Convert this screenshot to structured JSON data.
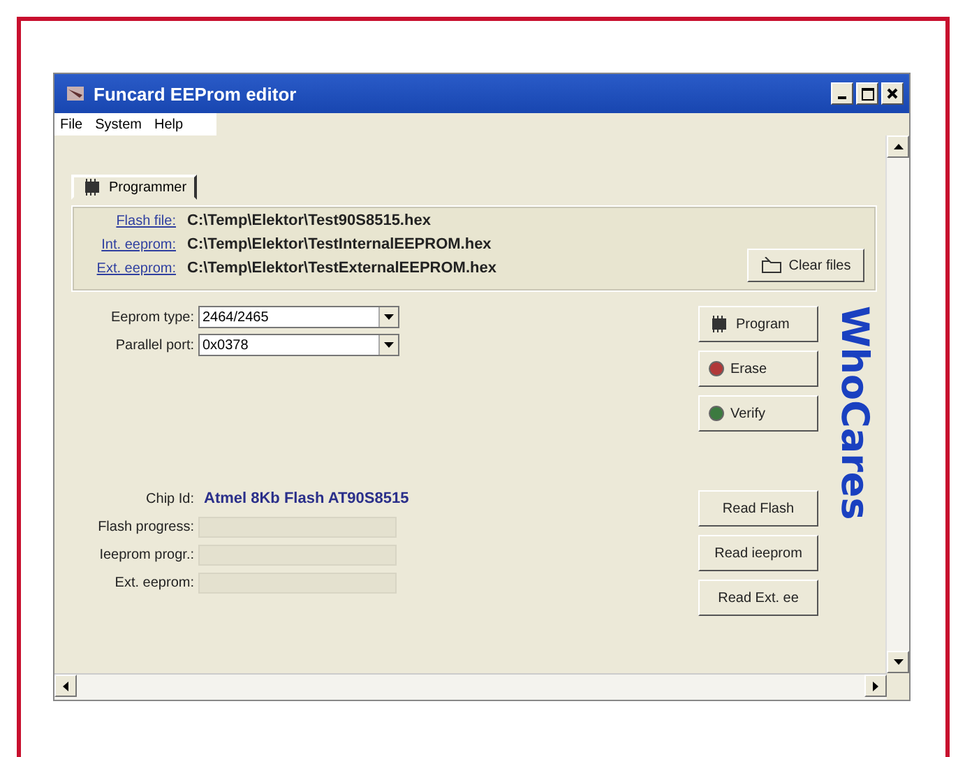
{
  "window": {
    "title": "Funcard EEProm editor"
  },
  "menu": [
    "File",
    "System",
    "Help"
  ],
  "tabs": [
    {
      "label": "Programmer",
      "selected": true
    }
  ],
  "files": [
    {
      "label": "Flash file:",
      "path": "C:\\Temp\\Elektor\\Test90S8515.hex"
    },
    {
      "label": "Int. eeprom:",
      "path": "C:\\Temp\\Elektor\\TestInternalEEPROM.hex"
    },
    {
      "label": "Ext. eeprom:",
      "path": "C:\\Temp\\Elektor\\TestExternalEEPROM.hex"
    }
  ],
  "clear_button": "Clear files",
  "settings": [
    {
      "label": "Eeprom type:",
      "value": "2464/2465"
    },
    {
      "label": "Parallel port:",
      "value": "0x0378"
    }
  ],
  "chip": {
    "label": "Chip Id:",
    "value": "Atmel 8Kb Flash AT90S8515"
  },
  "progress": [
    {
      "label": "Flash progress:",
      "level": 0
    },
    {
      "label": "Ieeprom progr.:",
      "level": 0
    },
    {
      "label": "Ext. eeprom:",
      "level": 0
    }
  ],
  "actions": [
    {
      "label": "Program",
      "kind": "program"
    },
    {
      "label": "Erase",
      "kind": "erase"
    },
    {
      "label": "Verify",
      "kind": "verify"
    }
  ],
  "read_buttons": [
    "Read Flash",
    "Read ieeprom",
    "Read Ext. ee"
  ],
  "brand": "WhoCares"
}
